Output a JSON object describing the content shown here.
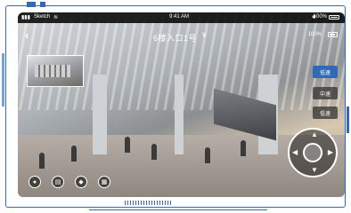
{
  "status_bar": {
    "carrier": "Sketch",
    "time": "9:41 AM",
    "battery_percent": "100%"
  },
  "header": {
    "back_icon": "chevron-left-icon",
    "title": "6楼入口1号",
    "title_caret_icon": "chevron-down-icon",
    "battery_label": "100%"
  },
  "speed_controls": {
    "low_label": "低速",
    "mid_label": "中速",
    "low2_label": "低速"
  },
  "toolbar": {
    "items": [
      {
        "icon": "mic-icon"
      },
      {
        "icon": "save-icon"
      },
      {
        "icon": "shield-icon"
      },
      {
        "icon": "document-icon"
      }
    ]
  },
  "colors": {
    "accent": "#2f69b8",
    "panel": "#3a3a3a"
  }
}
